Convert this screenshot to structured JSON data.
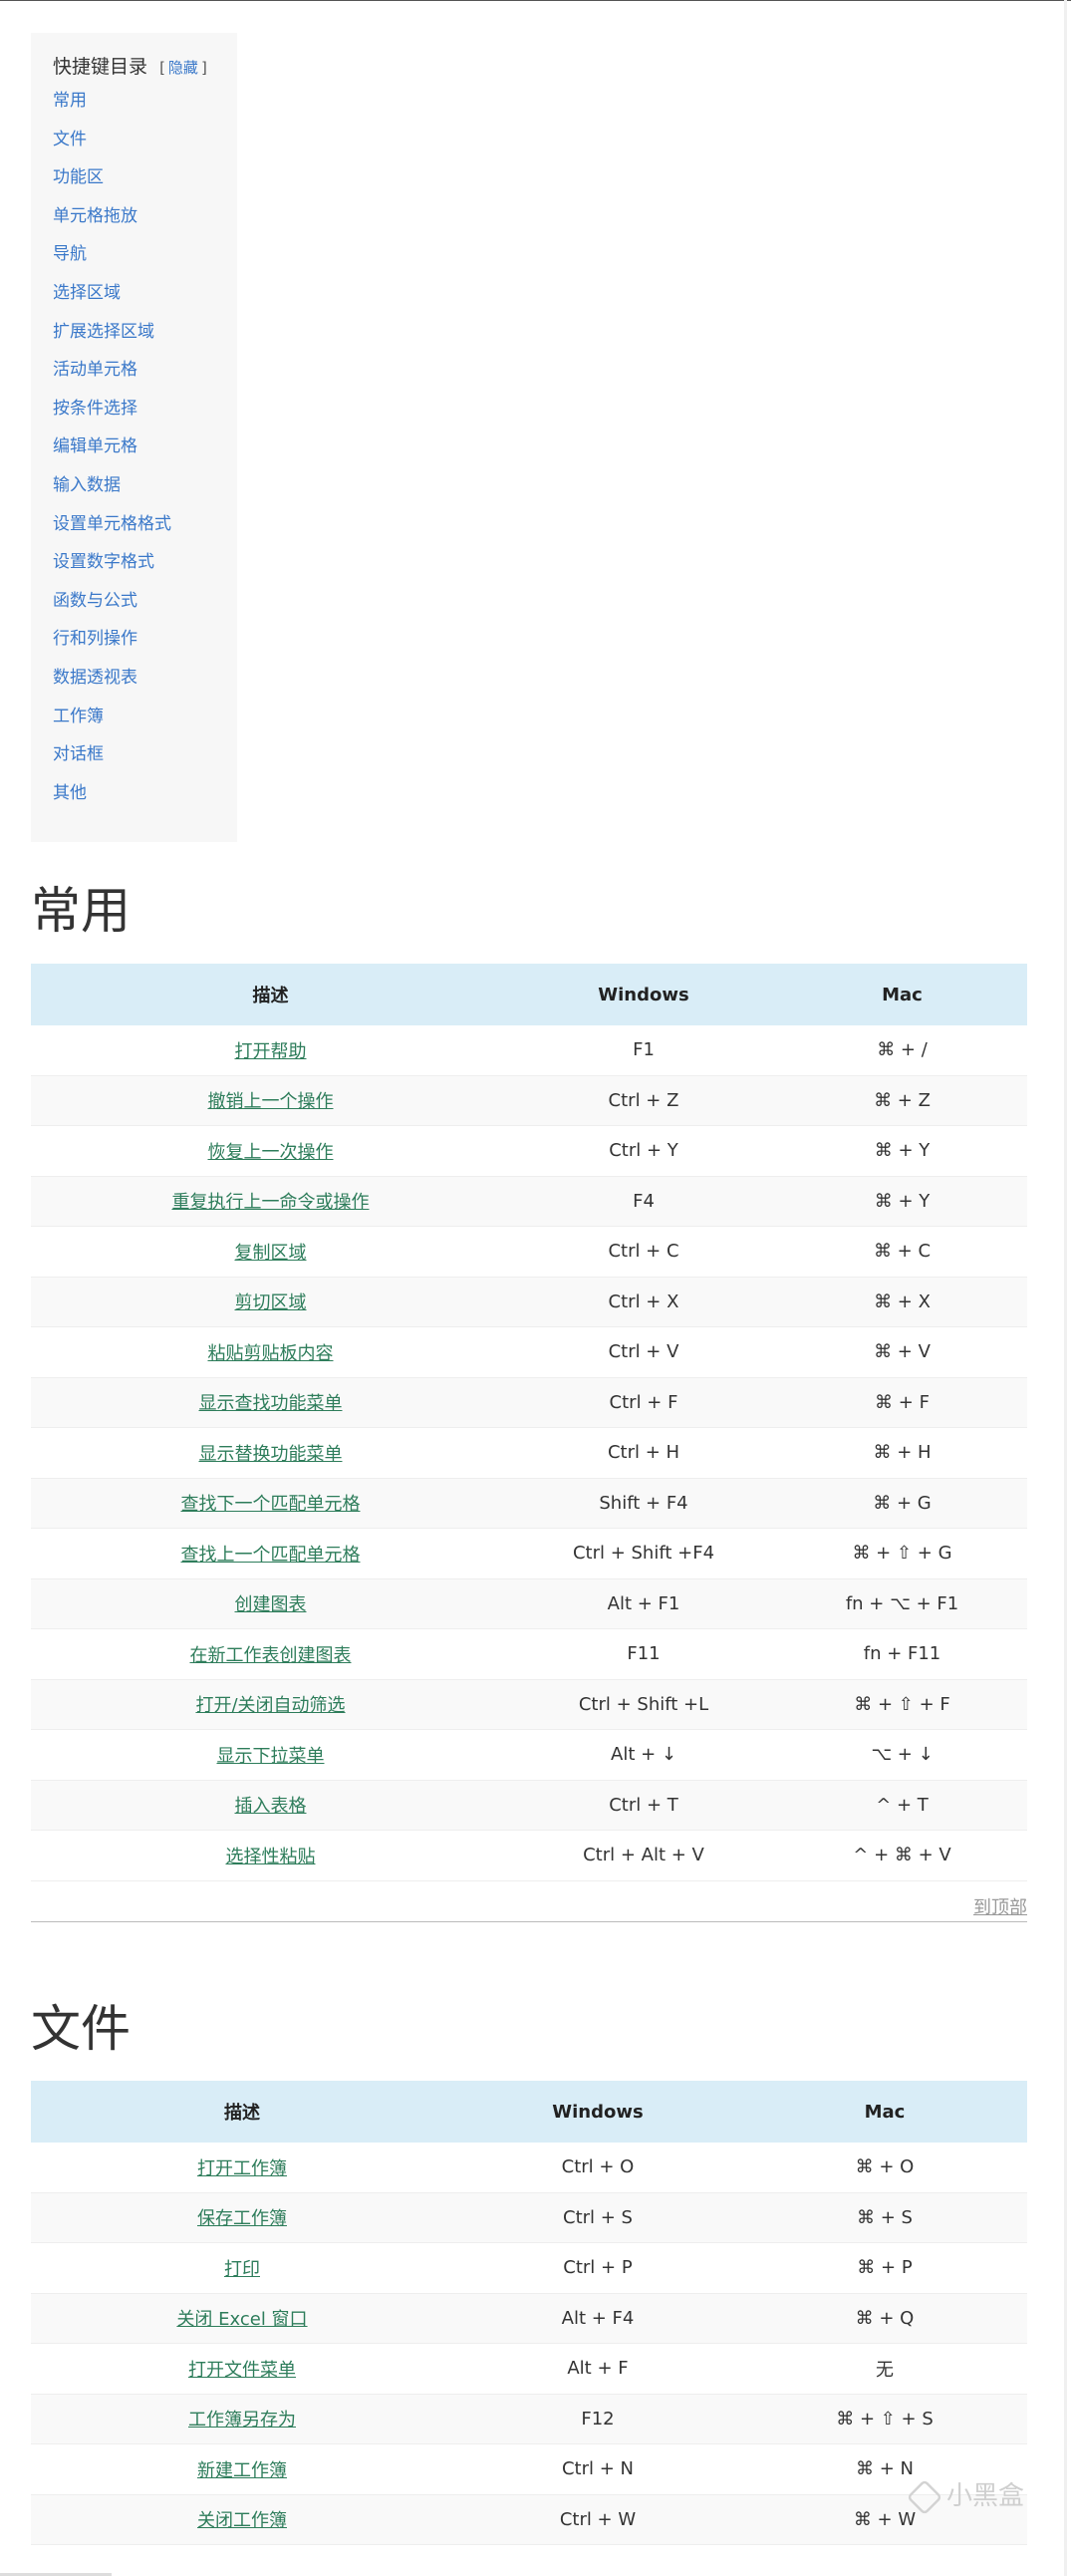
{
  "toc": {
    "title": "快捷键目录",
    "bracket_open": "[",
    "hide_label": "隐藏",
    "bracket_close": "]",
    "items": [
      "常用",
      "文件",
      "功能区",
      "单元格拖放",
      "导航",
      "选择区域",
      "扩展选择区域",
      "活动单元格",
      "按条件选择",
      "编辑单元格",
      "输入数据",
      "设置单元格格式",
      "设置数字格式",
      "函数与公式",
      "行和列操作",
      "数据透视表",
      "工作簿",
      "对话框",
      "其他"
    ]
  },
  "headers": {
    "desc": "描述",
    "windows": "Windows",
    "mac": "Mac"
  },
  "sections": [
    {
      "title": "常用",
      "rows": [
        {
          "desc": "打开帮助",
          "win": "F1",
          "mac": "⌘ + /"
        },
        {
          "desc": "撤销上一个操作",
          "win": "Ctrl + Z",
          "mac": "⌘ + Z"
        },
        {
          "desc": "恢复上一次操作",
          "win": "Ctrl + Y",
          "mac": "⌘ + Y"
        },
        {
          "desc": "重复执行上一命令或操作",
          "win": "F4",
          "mac": "⌘ + Y"
        },
        {
          "desc": "复制区域",
          "win": "Ctrl + C",
          "mac": "⌘ + C"
        },
        {
          "desc": "剪切区域",
          "win": "Ctrl + X",
          "mac": "⌘ + X"
        },
        {
          "desc": "粘贴剪贴板内容",
          "win": "Ctrl + V",
          "mac": "⌘ + V"
        },
        {
          "desc": "显示查找功能菜单",
          "win": "Ctrl + F",
          "mac": "⌘ + F"
        },
        {
          "desc": "显示替换功能菜单",
          "win": "Ctrl + H",
          "mac": "⌘ + H"
        },
        {
          "desc": "查找下一个匹配单元格",
          "win": "Shift + F4",
          "mac": "⌘ + G"
        },
        {
          "desc": "查找上一个匹配单元格",
          "win": "Ctrl + Shift +F4",
          "mac": "⌘ + ⇧ + G"
        },
        {
          "desc": "创建图表",
          "win": "Alt + F1",
          "mac": "fn + ⌥ + F1"
        },
        {
          "desc": "在新工作表创建图表",
          "win": "F11",
          "mac": "fn + F11"
        },
        {
          "desc": "打开/关闭自动筛选",
          "win": "Ctrl + Shift +L",
          "mac": "⌘ + ⇧ + F"
        },
        {
          "desc": "显示下拉菜单",
          "win": "Alt + ↓",
          "mac": "⌥ + ↓"
        },
        {
          "desc": "插入表格",
          "win": "Ctrl + T",
          "mac": "^ + T"
        },
        {
          "desc": "选择性粘贴",
          "win": "Ctrl + Alt + V",
          "mac": "^ + ⌘ + V"
        }
      ]
    },
    {
      "title": "文件",
      "rows": [
        {
          "desc": "打开工作簿",
          "win": "Ctrl + O",
          "mac": "⌘ + O"
        },
        {
          "desc": "保存工作簿",
          "win": "Ctrl + S",
          "mac": "⌘ + S"
        },
        {
          "desc": "打印",
          "win": "Ctrl + P",
          "mac": "⌘ + P"
        },
        {
          "desc": "关闭 Excel 窗口",
          "win": "Alt + F4",
          "mac": "⌘ + Q"
        },
        {
          "desc": "打开文件菜单",
          "win": "Alt + F",
          "mac": "无"
        },
        {
          "desc": "工作簿另存为",
          "win": "F12",
          "mac": "⌘ + ⇧ + S"
        },
        {
          "desc": "新建工作簿",
          "win": "Ctrl + N",
          "mac": "⌘ + N"
        },
        {
          "desc": "关闭工作簿",
          "win": "Ctrl + W",
          "mac": "⌘ + W"
        }
      ]
    }
  ],
  "to_top_label": "到顶部",
  "watermark": "小黑盒"
}
